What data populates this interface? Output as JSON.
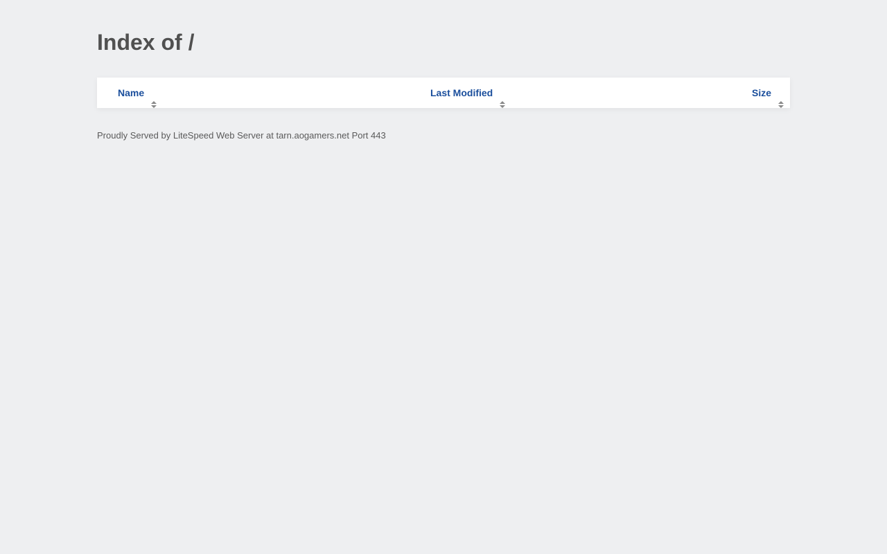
{
  "page": {
    "title": "Index of /"
  },
  "table": {
    "headers": [
      {
        "label": "Name",
        "icon": "sort-icon"
      },
      {
        "label": "Last Modified",
        "icon": "sort-icon"
      },
      {
        "label": "Size",
        "icon": "sort-icon"
      }
    ],
    "rows": []
  },
  "footer": {
    "text": "Proudly Served by LiteSpeed Web Server at tarn.aogamers.net Port 443"
  },
  "colors": {
    "background": "#eeeff1",
    "link": "#1a4e9c",
    "title": "#505050",
    "sort_icon": "#888888"
  }
}
